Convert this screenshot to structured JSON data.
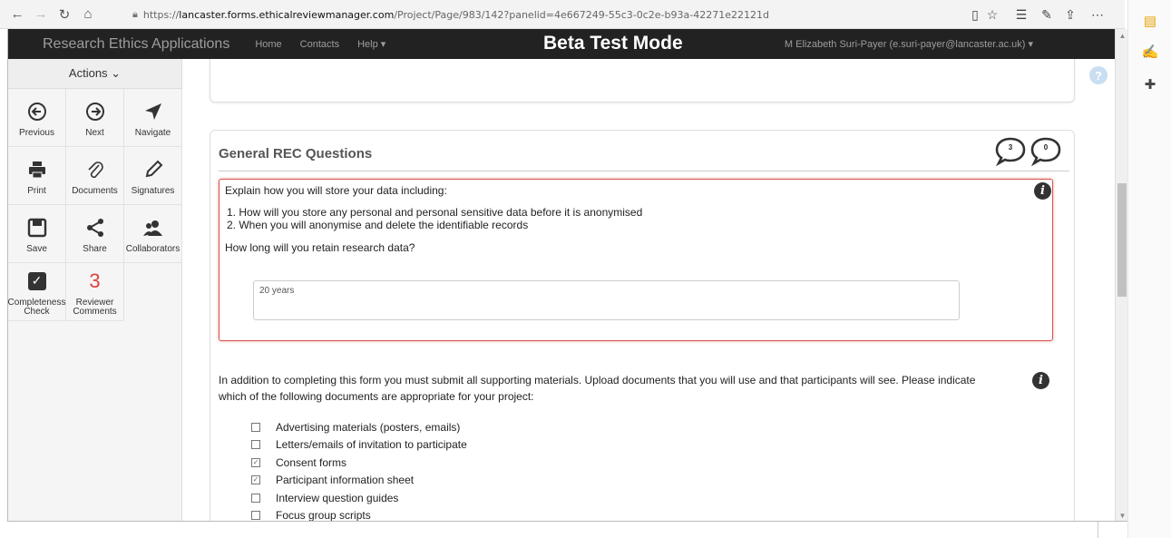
{
  "browser": {
    "url_prefix": "https://",
    "url_host": "lancaster.forms.ethicalreviewmanager.com",
    "url_path": "/Project/Page/983/142?panelid=4e667249-55c3-0c2e-b93a-42271e22121d"
  },
  "app": {
    "brand": "Research Ethics Applications",
    "nav": [
      "Home",
      "Contacts",
      "Help ▾"
    ],
    "mode": "Beta Test Mode",
    "user": "M Elizabeth Suri-Payer (e.suri-payer@lancaster.ac.uk) ▾"
  },
  "sidebar": {
    "header": "Actions ⌄",
    "actions": [
      {
        "label": "Previous",
        "icon": "previous-icon"
      },
      {
        "label": "Next",
        "icon": "next-icon"
      },
      {
        "label": "Navigate",
        "icon": "navigate-icon"
      },
      {
        "label": "Print",
        "icon": "print-icon"
      },
      {
        "label": "Documents",
        "icon": "paperclip-icon"
      },
      {
        "label": "Signatures",
        "icon": "pencil-icon"
      },
      {
        "label": "Save",
        "icon": "save-icon"
      },
      {
        "label": "Share",
        "icon": "share-icon"
      },
      {
        "label": "Collaborators",
        "icon": "users-icon"
      },
      {
        "label": "Completeness Check",
        "icon": "checkbox-icon"
      },
      {
        "label": "Reviewer Comments",
        "count": "3"
      }
    ]
  },
  "section": {
    "title": "General REC Questions",
    "comment_counts": [
      "3",
      "0"
    ]
  },
  "question": {
    "intro": "Explain how you will store your data including:",
    "items": [
      "1.  How will you store any personal and personal sensitive data before it is anonymised",
      "2.  When you will anonymise and delete the identifiable records"
    ],
    "prompt": "How long will you retain research data?",
    "answer": "20 years"
  },
  "upload": {
    "text": "In addition to completing this form you must submit all supporting materials. Upload documents that you will use and that participants will see. Please indicate which of the following documents are appropriate for your project:",
    "documents": [
      {
        "label": "Advertising materials (posters, emails)",
        "checked": false
      },
      {
        "label": "Letters/emails of invitation to participate",
        "checked": false
      },
      {
        "label": "Consent forms",
        "checked": true
      },
      {
        "label": "Participant information sheet",
        "checked": true
      },
      {
        "label": "Interview question guides",
        "checked": false
      },
      {
        "label": "Focus group scripts",
        "checked": false
      }
    ]
  }
}
